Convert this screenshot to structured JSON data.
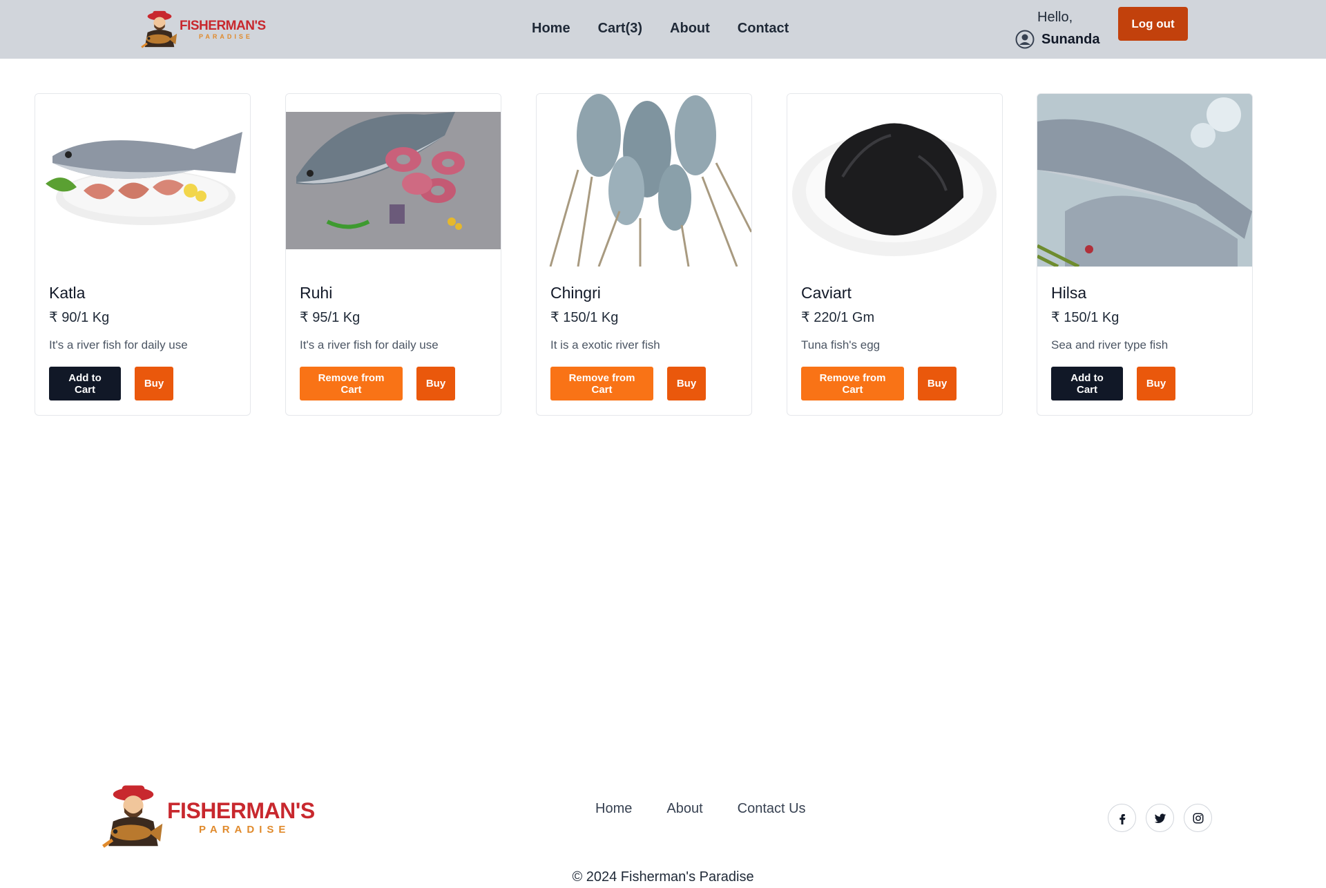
{
  "header": {
    "logo": {
      "title": "FISHERMAN'S",
      "subtitle": "PARADISE"
    },
    "nav": [
      "Home",
      "Cart(3)",
      "About",
      "Contact"
    ],
    "greeting": "Hello,",
    "username": "Sunanda",
    "logout_label": "Log out"
  },
  "products": [
    {
      "name": "Katla",
      "price": "₹ 90/1 Kg",
      "description": "It's a river fish for daily use",
      "cart_label": "Add to Cart",
      "buy_label": "Buy"
    },
    {
      "name": "Ruhi",
      "price": "₹ 95/1 Kg",
      "description": "It's a river fish for daily use",
      "cart_label": "Remove from Cart",
      "buy_label": "Buy"
    },
    {
      "name": "Chingri",
      "price": "₹ 150/1 Kg",
      "description": "It is a exotic river fish",
      "cart_label": "Remove from Cart",
      "buy_label": "Buy"
    },
    {
      "name": "Caviart",
      "price": "₹ 220/1 Gm",
      "description": "Tuna fish's egg",
      "cart_label": "Remove from Cart",
      "buy_label": "Buy"
    },
    {
      "name": "Hilsa",
      "price": "₹ 150/1 Kg",
      "description": "Sea and river type fish",
      "cart_label": "Add to Cart",
      "buy_label": "Buy"
    }
  ],
  "footer": {
    "logo": {
      "title": "FISHERMAN'S",
      "subtitle": "PARADISE"
    },
    "nav": [
      "Home",
      "About",
      "Contact Us"
    ],
    "social": [
      "facebook-icon",
      "twitter-icon",
      "instagram-icon"
    ],
    "copyright": "© 2024 Fisherman's Paradise"
  },
  "colors": {
    "header_bg": "#d1d5db",
    "logout": "#c2410c",
    "add_to_cart": "#111827",
    "remove_from_cart": "#f97316",
    "buy": "#ea580c",
    "logo_red": "#c8282e",
    "logo_orange": "#e08a2c"
  }
}
